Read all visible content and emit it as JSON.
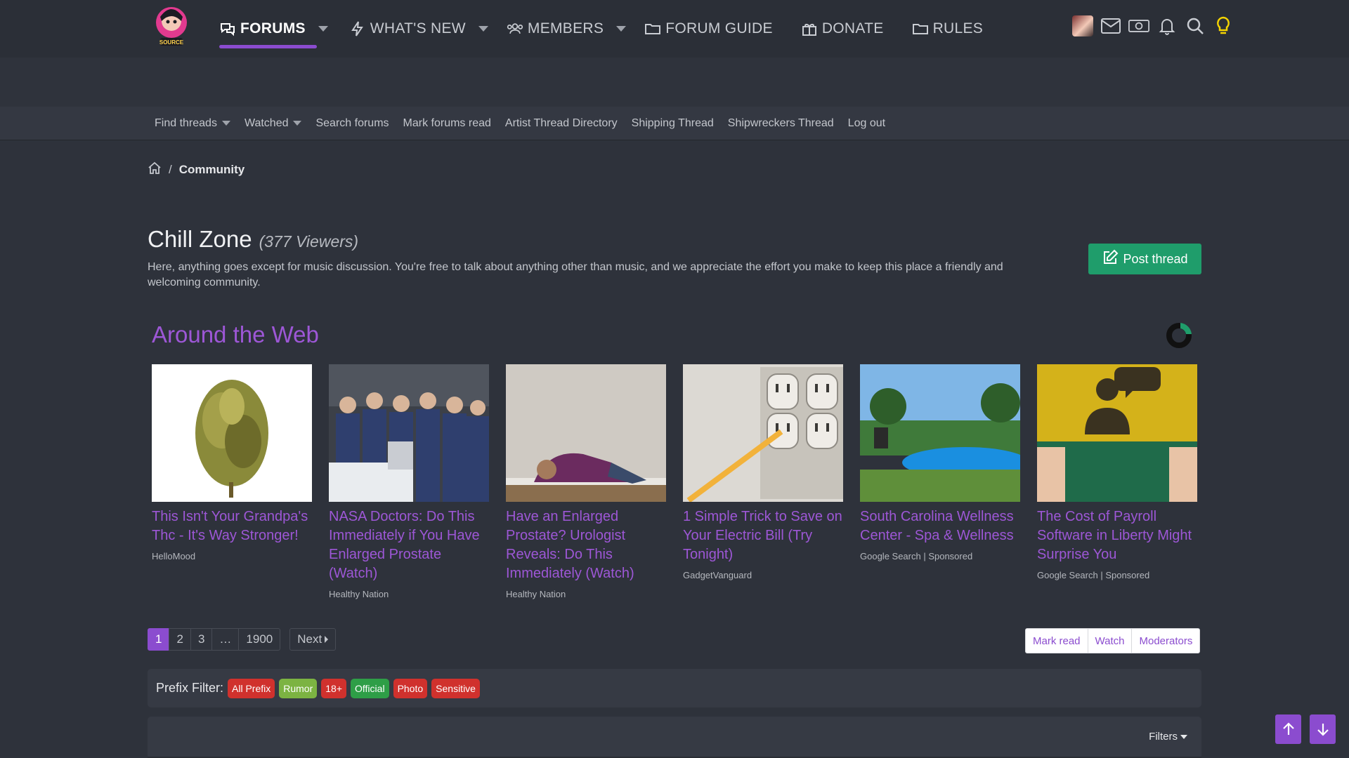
{
  "nav": {
    "tabs": [
      {
        "label": "FORUMS",
        "icon": "chat-bubbles-icon"
      },
      {
        "label": "WHAT'S NEW",
        "icon": "lightning-icon"
      },
      {
        "label": "MEMBERS",
        "icon": "users-icon"
      },
      {
        "label": "FORUM GUIDE",
        "icon": "folder-icon"
      },
      {
        "label": "DONATE",
        "icon": "gift-icon"
      },
      {
        "label": "RULES",
        "icon": "folder-icon"
      }
    ],
    "logo_text": "SOURCE"
  },
  "subnav": {
    "items": [
      "Find threads",
      "Watched",
      "Search forums",
      "Mark forums read",
      "Artist Thread Directory",
      "Shipping Thread",
      "Shipwreckers Thread",
      "Log out"
    ]
  },
  "breadcrumb": {
    "current": "Community"
  },
  "forum": {
    "title": "Chill Zone",
    "viewers": "(377 Viewers)",
    "description": "Here, anything goes except for music discussion. You're free to talk about anything other than music, and we appreciate the effort you make to keep this place a friendly and welcoming community.",
    "post_button": "Post thread"
  },
  "around_web": {
    "title": "Around the Web",
    "cards": [
      {
        "headline": "This Isn't Your Grandpa's Thc - It's Way Stronger!",
        "source": "HelloMood"
      },
      {
        "headline": "NASA Doctors: Do This Immediately if You Have Enlarged Prostate (Watch)",
        "source": "Healthy Nation"
      },
      {
        "headline": "Have an Enlarged Prostate? Urologist Reveals: Do This Immediately (Watch)",
        "source": "Healthy Nation"
      },
      {
        "headline": "1 Simple Trick to Save on Your Electric Bill (Try Tonight)",
        "source": "GadgetVanguard"
      },
      {
        "headline": "South Carolina Wellness Center - Spa & Wellness",
        "source": "Google Search | Sponsored"
      },
      {
        "headline": "The Cost of Payroll Software in Liberty Might Surprise You",
        "source": "Google Search | Sponsored"
      }
    ]
  },
  "pagination": {
    "pages": [
      "1",
      "2",
      "3",
      "…",
      "1900"
    ],
    "next": "Next"
  },
  "actions": [
    "Mark read",
    "Watch",
    "Moderators"
  ],
  "prefix_filter": {
    "label": "Prefix Filter:",
    "badges": [
      {
        "label": "All Prefix",
        "color": "#d0312d"
      },
      {
        "label": "Rumor",
        "color": "#7cb342"
      },
      {
        "label": "18+",
        "color": "#d0312d"
      },
      {
        "label": "Official",
        "color": "#2e9e47"
      },
      {
        "label": "Photo",
        "color": "#d0312d"
      },
      {
        "label": "Sensitive",
        "color": "#d0312d"
      }
    ]
  },
  "filters": {
    "label": "Filters"
  },
  "colors": {
    "accent": "#8b4ccf",
    "post_button": "#1f9d6b",
    "ad_link": "#9d57d6"
  }
}
